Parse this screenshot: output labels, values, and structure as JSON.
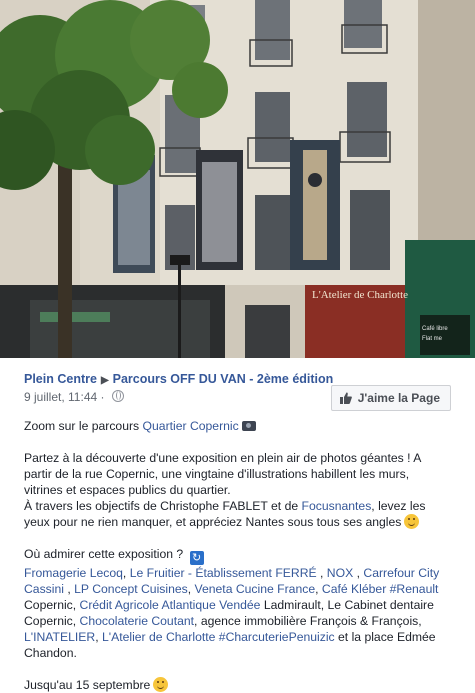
{
  "post": {
    "page_name": "Plein Centre",
    "event_name": "Parcours OFF DU VAN - 2ème édition",
    "date": "9 juillet, 11:44",
    "like_button": "J'aime la Page"
  },
  "photo": {
    "shop_sign": "L'Atelier de Charlotte",
    "side_sign_line1": "Café libre",
    "side_sign_line2": "Flat me",
    "icons": [
      "globe-icon",
      "thumb-up-icon",
      "camera-icon",
      "smile-icon",
      "arrows-icon",
      "wink-icon"
    ]
  },
  "text": {
    "p1_prefix": "Zoom sur le parcours ",
    "p1_link": "Quartier Copernic",
    "p2_a": "Partez à la découverte d'une exposition en plein air de photos géantes ! A partir de la rue Copernic, une vingtaine d'illustrations habillent les murs, vitrines et espaces publics du quartier.",
    "p2_b1": "À travers les objectifs de Christophe FABLET et de ",
    "p2_b_link": "Focusnantes",
    "p2_b2": ", levez les yeux pour ne rien manquer, et appréciez Nantes sous tous ses angles",
    "p3_q": "Où admirer cette exposition ?",
    "l1": "Fromagerie Lecoq",
    "s1": ", ",
    "l2": "Le Fruitier - Établissement FERRÉ",
    "s2": " , ",
    "l3": "NOX",
    "s3": " , ",
    "l4": "Carrefour City Cassini",
    "s4": " , ",
    "l5": "LP Concept Cuisines",
    "s5": ", ",
    "l6": "Veneta Cucine France",
    "s6": ", ",
    "l7": "Café Kléber",
    "s7": " ",
    "l8": "#Renault",
    "s8": " Copernic, ",
    "l9": "Crédit Agricole Atlantique Vendée",
    "s9": " Ladmirault, Le Cabinet dentaire Copernic, ",
    "l10": "Chocolaterie Coutant",
    "s10": ", agence immobilière François & François, ",
    "l11": "L'INATELIER",
    "s11": ", ",
    "l12": "L'Atelier de Charlotte",
    "s12": " ",
    "l13": "#CharcuteriePenuizic",
    "s13": " et la place Edmée Chandon.",
    "p4": "Jusqu'au 15 septembre"
  }
}
